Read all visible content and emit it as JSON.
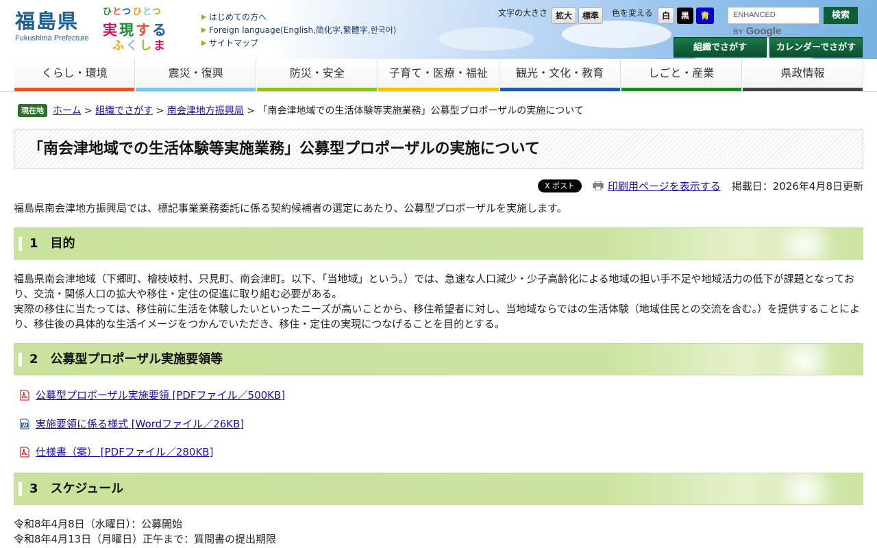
{
  "header": {
    "logo_kanji": "福島県",
    "logo_roman": "Fukushima Prefecture",
    "slogan_chars": [
      "ひ",
      "と",
      "つ",
      "ひ",
      "と",
      "つ",
      "実",
      "現",
      "す",
      "る",
      "ふ",
      "く",
      "し",
      "ま"
    ],
    "quick_links": [
      {
        "label": "はじめての方へ"
      },
      {
        "label": "Foreign language(English,简化字,繁體字,한국어)"
      },
      {
        "label": "サイトマップ"
      }
    ],
    "font_size_label": "文字の大きさ",
    "font_size_buttons": [
      "拡大",
      "標準"
    ],
    "color_label": "色を変える",
    "color_buttons": [
      "白",
      "黒",
      "青"
    ],
    "search_placeholder": "ENHANCED BY",
    "search_brand": "Google",
    "search_button": "検索",
    "org_search_button": "組織でさがす",
    "calendar_search_button": "カレンダーでさがす"
  },
  "gnav": {
    "items": [
      {
        "label": "くらし・環境",
        "color": "#e2572b"
      },
      {
        "label": "震災・復興",
        "color": "#7ac7ea"
      },
      {
        "label": "防災・安全",
        "color": "#8dc21f"
      },
      {
        "label": "子育て・医療・福祉",
        "color": "#f5c400"
      },
      {
        "label": "観光・文化・教育",
        "color": "#1f59a8"
      },
      {
        "label": "しごと・産業",
        "color": "#1f8a1f"
      },
      {
        "label": "県政情報",
        "color": "#444444"
      }
    ]
  },
  "breadcrumb": {
    "here_label": "現在地",
    "home": "ホーム",
    "org": "組織でさがす",
    "office": "南会津地方振興局",
    "current": "「南会津地域での生活体験等実施業務」公募型プロポーザルの実施について"
  },
  "page": {
    "title": "「南会津地域での生活体験等実施業務」公募型プロポーザルの実施について",
    "x_post": "X ポスト",
    "print_link": "印刷用ページを表示する",
    "updated": "掲載日：2026年4月8日更新",
    "intro": "福島県南会津地方振興局では、標記事業業務委託に係る契約候補者の選定にあたり、公募型プロポーザルを実施します。"
  },
  "sections": [
    {
      "heading": "1　目的",
      "paragraphs": [
        "福島県南会津地域（下郷町、檜枝岐村、只見町、南会津町。以下、「当地域」という。）では、急速な人口減少・少子高齢化による地域の担い手不足や地域活力の低下が課題となっており、交流・関係人口の拡大や移住・定住の促進に取り組む必要がある。",
        "実際の移住に当たっては、移住前に生活を体験したいといったニーズが高いことから、移住希望者に対し、当地域ならではの生活体験（地域住民との交流を含む。）を提供することにより、移住後の具体的な生活イメージをつかんでいただき、移住・定住の実現につなげることを目的とする。"
      ]
    },
    {
      "heading": "2　公募型プロポーザル実施要領等",
      "files": [
        {
          "label": "公募型プロポーザル実施要領 [PDFファイル／500KB]",
          "icon": "pdf-icon"
        },
        {
          "label": "実施要領に係る様式 [Wordファイル／26KB]",
          "icon": "word-icon"
        },
        {
          "label": "仕様書（案） [PDFファイル／280KB]",
          "icon": "pdf-icon"
        }
      ]
    },
    {
      "heading": "3　スケジュール",
      "paragraphs": [
        "令和8年4月8日（水曜日）：公募開始",
        "令和8年4月13日（月曜日）正午まで：質問書の提出期限"
      ]
    }
  ]
}
